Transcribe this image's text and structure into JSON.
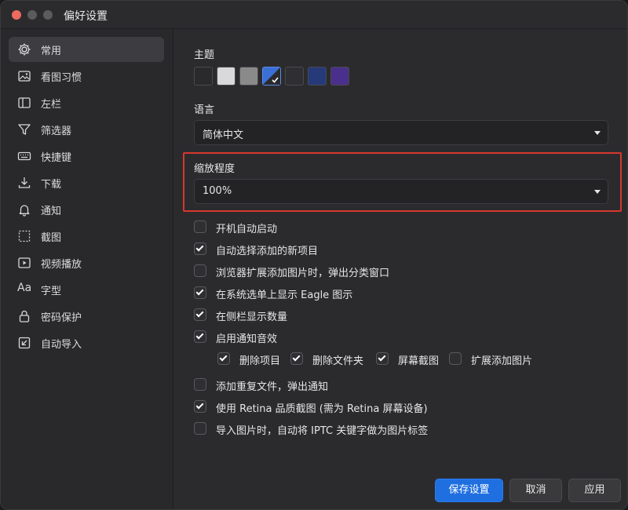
{
  "window": {
    "title": "偏好设置"
  },
  "sidebar": {
    "items": [
      {
        "label": "常用",
        "icon": "gear-icon",
        "active": true
      },
      {
        "label": "看图习惯",
        "icon": "image-icon"
      },
      {
        "label": "左栏",
        "icon": "sidebar-icon"
      },
      {
        "label": "筛选器",
        "icon": "filter-icon"
      },
      {
        "label": "快捷键",
        "icon": "keyboard-icon"
      },
      {
        "label": "下载",
        "icon": "download-icon"
      },
      {
        "label": "通知",
        "icon": "bell-icon"
      },
      {
        "label": "截图",
        "icon": "screenshot-icon"
      },
      {
        "label": "视频播放",
        "icon": "video-icon"
      },
      {
        "label": "字型",
        "icon": "font-icon"
      },
      {
        "label": "密码保护",
        "icon": "lock-icon"
      },
      {
        "label": "自动导入",
        "icon": "import-icon"
      }
    ]
  },
  "theme": {
    "label": "主题",
    "swatches": [
      "#2a2a2c",
      "#d9d9d9",
      "#8a8a8a",
      "#3a6fd6",
      "#2f2f32",
      "#263a7a",
      "#4a2f8c"
    ],
    "selected_index": 3
  },
  "language": {
    "label": "语言",
    "value": "简体中文"
  },
  "zoom": {
    "label": "缩放程度",
    "value": "100%"
  },
  "options": [
    {
      "label": "开机自动启动",
      "checked": false
    },
    {
      "label": "自动选择添加的新项目",
      "checked": true
    },
    {
      "label": "浏览器扩展添加图片时，弹出分类窗口",
      "checked": false
    },
    {
      "label": "在系统选单上显示 Eagle 图示",
      "checked": true
    },
    {
      "label": "在侧栏显示数量",
      "checked": true
    },
    {
      "label": "启用通知音效",
      "checked": true
    }
  ],
  "sound_options": [
    {
      "label": "删除项目",
      "checked": true
    },
    {
      "label": "删除文件夹",
      "checked": true
    },
    {
      "label": "屏幕截图",
      "checked": true
    },
    {
      "label": "扩展添加图片",
      "checked": false
    }
  ],
  "options2": [
    {
      "label": "添加重复文件，弹出通知",
      "checked": false
    },
    {
      "label": "使用 Retina 品质截图 (需为 Retina 屏幕设备)",
      "checked": true
    },
    {
      "label": "导入图片时，自动将 IPTC 关键字做为图片标签",
      "checked": false
    }
  ],
  "buttons": {
    "save": "保存设置",
    "cancel": "取消",
    "apply": "应用"
  }
}
